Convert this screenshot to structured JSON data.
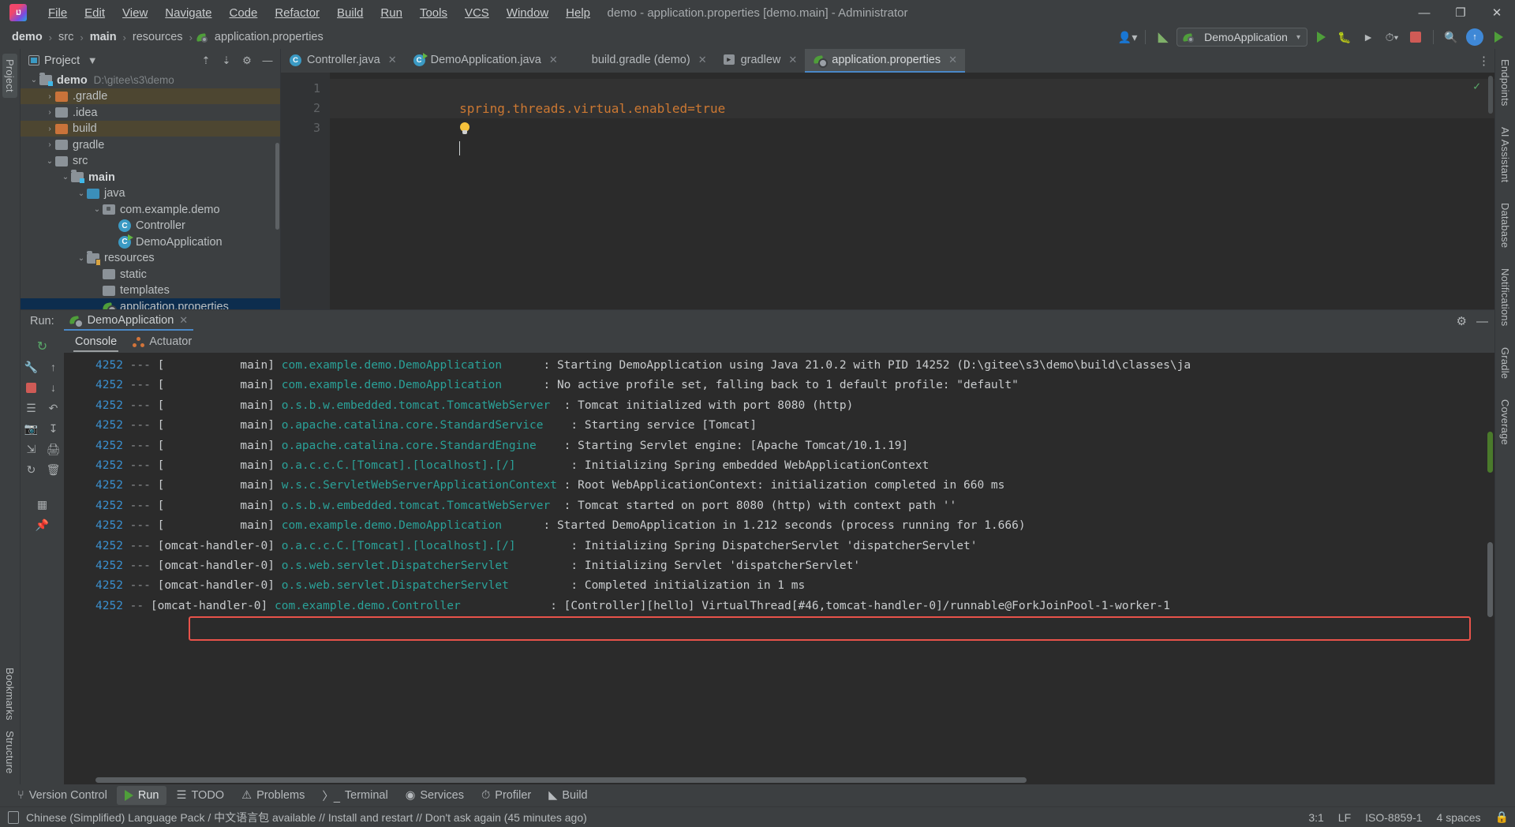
{
  "titlebar": {
    "logo_alt": "intellij-idea-logo",
    "menu": [
      "File",
      "Edit",
      "View",
      "Navigate",
      "Code",
      "Refactor",
      "Build",
      "Run",
      "Tools",
      "VCS",
      "Window",
      "Help"
    ],
    "window_title": "demo - application.properties [demo.main] - Administrator",
    "minimize": "—",
    "maximize": "❐",
    "close": "✕"
  },
  "navbar": {
    "breadcrumbs": [
      "demo",
      "src",
      "main",
      "resources",
      "application.properties"
    ],
    "separator": "›",
    "run_config": "DemoApplication",
    "icons": {
      "account": "account-icon",
      "build_hammer": "⚒",
      "reload": "↺",
      "debug": "debug-icon",
      "run_coverage": "coverage-icon",
      "profiler": "profiler-icon",
      "stop": "stop-icon",
      "search": "⌕",
      "updates": "↑",
      "run": "run-icon"
    }
  },
  "left_stripe": {
    "tabs": [
      "Project",
      "Bookmarks",
      "Structure"
    ]
  },
  "right_stripe": {
    "tabs": [
      "Endpoints",
      "AI Assistant",
      "Database",
      "Notifications",
      "Gradle",
      "Coverage"
    ]
  },
  "project_panel": {
    "title": "Project",
    "chevron": "▼",
    "collapse_all_icon": "collapse-all-icon",
    "expand_icon": "expand-icon",
    "settings_icon": "⚙",
    "hide_icon": "—",
    "tree": [
      {
        "label": "demo",
        "path": "D:\\gitee\\s3\\demo",
        "depth": 0,
        "arrow": "⌄",
        "icon": "module-folder",
        "bold": true,
        "state": "normal"
      },
      {
        "label": ".gradle",
        "path": "",
        "depth": 1,
        "arrow": "›",
        "icon": "folder-orange",
        "bold": false,
        "state": "mark"
      },
      {
        "label": ".idea",
        "path": "",
        "depth": 1,
        "arrow": "›",
        "icon": "folder-gray",
        "bold": false,
        "state": "normal"
      },
      {
        "label": "build",
        "path": "",
        "depth": 1,
        "arrow": "›",
        "icon": "folder-orange",
        "bold": false,
        "state": "mark"
      },
      {
        "label": "gradle",
        "path": "",
        "depth": 1,
        "arrow": "›",
        "icon": "folder-gray",
        "bold": false,
        "state": "normal"
      },
      {
        "label": "src",
        "path": "",
        "depth": 1,
        "arrow": "⌄",
        "icon": "folder-gray",
        "bold": false,
        "state": "normal"
      },
      {
        "label": "main",
        "path": "",
        "depth": 2,
        "arrow": "⌄",
        "icon": "module-folder",
        "bold": true,
        "state": "normal"
      },
      {
        "label": "java",
        "path": "",
        "depth": 3,
        "arrow": "⌄",
        "icon": "folder-blue",
        "bold": false,
        "state": "normal"
      },
      {
        "label": "com.example.demo",
        "path": "",
        "depth": 4,
        "arrow": "⌄",
        "icon": "folder-package",
        "bold": false,
        "state": "normal"
      },
      {
        "label": "Controller",
        "path": "",
        "depth": 5,
        "arrow": "",
        "icon": "class-icon",
        "bold": false,
        "state": "normal"
      },
      {
        "label": "DemoApplication",
        "path": "",
        "depth": 5,
        "arrow": "",
        "icon": "class-runnable-icon",
        "bold": false,
        "state": "normal"
      },
      {
        "label": "resources",
        "path": "",
        "depth": 3,
        "arrow": "⌄",
        "icon": "folder-resources",
        "bold": false,
        "state": "normal"
      },
      {
        "label": "static",
        "path": "",
        "depth": 4,
        "arrow": "",
        "icon": "folder-gray",
        "bold": false,
        "state": "normal"
      },
      {
        "label": "templates",
        "path": "",
        "depth": 4,
        "arrow": "",
        "icon": "folder-gray",
        "bold": false,
        "state": "normal"
      },
      {
        "label": "application.properties",
        "path": "",
        "depth": 4,
        "arrow": "",
        "icon": "spring-leaf-icon",
        "bold": false,
        "state": "sel"
      }
    ]
  },
  "editor": {
    "tabs": [
      {
        "label": "Controller.java",
        "icon": "class-icon",
        "active": false,
        "close": "✕"
      },
      {
        "label": "DemoApplication.java",
        "icon": "class-runnable-icon",
        "active": false,
        "close": "✕"
      },
      {
        "label": "build.gradle (demo)",
        "icon": "gradle-icon",
        "active": false,
        "close": "✕"
      },
      {
        "label": "gradlew",
        "icon": "shell-script-icon",
        "active": false,
        "close": "✕"
      },
      {
        "label": "application.properties",
        "icon": "spring-leaf-icon",
        "active": true,
        "close": "✕"
      }
    ],
    "tabs_more_icon": "⋮",
    "gutter_lines": [
      "1",
      "2",
      "3"
    ],
    "lines": [
      {
        "num": "1",
        "text": "spring.threads.virtual.enabled=true",
        "kind": "property"
      },
      {
        "num": "2",
        "text": "",
        "kind": "bulb"
      },
      {
        "num": "3",
        "text": "",
        "kind": "caret"
      }
    ],
    "inspection_status": "✓"
  },
  "run_panel": {
    "label": "Run:",
    "config_tab": "DemoApplication",
    "config_close": "✕",
    "settings_icon": "⚙",
    "hide_icon": "—",
    "tabs": [
      {
        "label": "Console",
        "active": true
      },
      {
        "label": "Actuator",
        "active": false
      }
    ],
    "toolbar_icons": [
      "rerun-icon",
      "scroll-up-icon",
      "scroll-down-icon",
      "stop-icon",
      "soft-wrap-icon",
      "thread-dump-icon",
      "scroll-to-end-icon",
      "print-icon",
      "camera-icon",
      "export-icon",
      "clear-all-icon",
      "layout-icon",
      "pin-icon"
    ],
    "console_lines": [
      {
        "pid": "4252",
        "dash": "---",
        "thread": "[           main]",
        "logger": "com.example.demo.DemoApplication",
        "msg": ": Starting DemoApplication using Java 21.0.2 with PID 14252 (D:\\gitee\\s3\\demo\\build\\classes\\ja",
        "boxed": false
      },
      {
        "pid": "4252",
        "dash": "---",
        "thread": "[           main]",
        "logger": "com.example.demo.DemoApplication",
        "msg": ": No active profile set, falling back to 1 default profile: \"default\"",
        "boxed": false
      },
      {
        "pid": "4252",
        "dash": "---",
        "thread": "[           main]",
        "logger": "o.s.b.w.embedded.tomcat.TomcatWebServer",
        "msg": ": Tomcat initialized with port 8080 (http)",
        "boxed": false
      },
      {
        "pid": "4252",
        "dash": "---",
        "thread": "[           main]",
        "logger": "o.apache.catalina.core.StandardService",
        "msg": ": Starting service [Tomcat]",
        "boxed": false
      },
      {
        "pid": "4252",
        "dash": "---",
        "thread": "[           main]",
        "logger": "o.apache.catalina.core.StandardEngine",
        "msg": ": Starting Servlet engine: [Apache Tomcat/10.1.19]",
        "boxed": false
      },
      {
        "pid": "4252",
        "dash": "---",
        "thread": "[           main]",
        "logger": "o.a.c.c.C.[Tomcat].[localhost].[/]",
        "msg": ": Initializing Spring embedded WebApplicationContext",
        "boxed": false
      },
      {
        "pid": "4252",
        "dash": "---",
        "thread": "[           main]",
        "logger": "w.s.c.ServletWebServerApplicationContext",
        "msg": ": Root WebApplicationContext: initialization completed in 660 ms",
        "boxed": false
      },
      {
        "pid": "4252",
        "dash": "---",
        "thread": "[           main]",
        "logger": "o.s.b.w.embedded.tomcat.TomcatWebServer",
        "msg": ": Tomcat started on port 8080 (http) with context path ''",
        "boxed": false
      },
      {
        "pid": "4252",
        "dash": "---",
        "thread": "[           main]",
        "logger": "com.example.demo.DemoApplication",
        "msg": ": Started DemoApplication in 1.212 seconds (process running for 1.666)",
        "boxed": false
      },
      {
        "pid": "4252",
        "dash": "---",
        "thread": "[omcat-handler-0]",
        "logger": "o.a.c.c.C.[Tomcat].[localhost].[/]",
        "msg": ": Initializing Spring DispatcherServlet 'dispatcherServlet'",
        "boxed": false
      },
      {
        "pid": "4252",
        "dash": "---",
        "thread": "[omcat-handler-0]",
        "logger": "o.s.web.servlet.DispatcherServlet",
        "msg": ": Initializing Servlet 'dispatcherServlet'",
        "boxed": false
      },
      {
        "pid": "4252",
        "dash": "---",
        "thread": "[omcat-handler-0]",
        "logger": "o.s.web.servlet.DispatcherServlet",
        "msg": ": Completed initialization in 1 ms",
        "boxed": false
      },
      {
        "pid": "4252",
        "dash": "--",
        "thread": "[omcat-handler-0]",
        "logger": "com.example.demo.Controller",
        "msg": ": [Controller][hello] VirtualThread[#46,tomcat-handler-0]/runnable@ForkJoinPool-1-worker-1",
        "boxed": true
      }
    ],
    "highlight_color": "#e8534a"
  },
  "toolwindow_bar": {
    "items": [
      {
        "label": "Version Control",
        "icon": "branch-icon",
        "active": false
      },
      {
        "label": "Run",
        "icon": "run-icon",
        "active": true
      },
      {
        "label": "TODO",
        "icon": "list-icon",
        "active": false
      },
      {
        "label": "Problems",
        "icon": "warning-icon",
        "active": false
      },
      {
        "label": "Terminal",
        "icon": "terminal-icon",
        "active": false
      },
      {
        "label": "Services",
        "icon": "services-icon",
        "active": false
      },
      {
        "label": "Profiler",
        "icon": "profiler-icon",
        "active": false
      },
      {
        "label": "Build",
        "icon": "hammer-icon",
        "active": false
      }
    ]
  },
  "statusbar": {
    "notification_icon": "notification-icon",
    "message": "Chinese (Simplified) Language Pack / 中文语言包 available // Install and restart // Don't ask again (45 minutes ago)",
    "caret_position": "3:1",
    "line_separator": "LF",
    "encoding": "ISO-8859-1",
    "indent": "4 spaces",
    "lock_icon": "lock-icon"
  },
  "colors": {
    "accent_blue": "#4a88c7",
    "spring_green": "#4f9e3a",
    "logger_teal": "#2aa198",
    "pid_blue": "#3a8fce",
    "property_orange": "#cc7832",
    "selection": "#0d2d4e",
    "highlight_box": "#e8534a",
    "panel_bg": "#3c3f41",
    "editor_bg": "#2b2b2b"
  }
}
